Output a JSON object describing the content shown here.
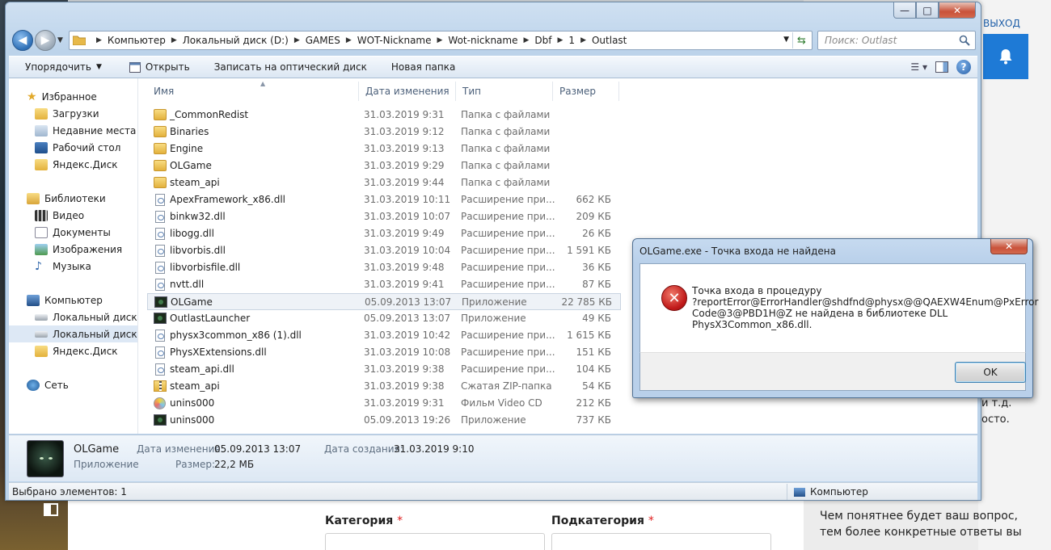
{
  "background": {
    "exit_link": "ВЫХОД",
    "side_fragments": [
      "и т.д.",
      "осто."
    ],
    "form": {
      "category_label": "Категория",
      "subcategory_label": "Подкатегория",
      "required_mark": "*"
    },
    "side_text": [
      "Чем понятнее будет ваш вопрос,",
      "тем более конкретные ответы вы"
    ]
  },
  "explorer": {
    "window_controls": {
      "minimize": "—",
      "maximize": "□",
      "close": "✕"
    },
    "breadcrumbs": [
      "Компьютер",
      "Локальный диск (D:)",
      "GAMES",
      "WOT-Nickname",
      "Wot-nickname",
      "Dbf",
      "1",
      "Outlast"
    ],
    "search_placeholder": "Поиск: Outlast",
    "toolbar": {
      "organize": "Упорядочить",
      "open": "Открыть",
      "burn": "Записать на оптический диск",
      "new_folder": "Новая папка"
    },
    "nav": {
      "favorites": "Избранное",
      "downloads": "Загрузки",
      "recent": "Недавние места",
      "desktop": "Рабочий стол",
      "yadisk": "Яндекс.Диск",
      "libraries": "Библиотеки",
      "video": "Видео",
      "documents": "Документы",
      "images": "Изображения",
      "music": "Музыка",
      "computer": "Компьютер",
      "local_c": "Локальный диск (C:)",
      "local_d": "Локальный диск (D:)",
      "yadisk2": "Яндекс.Диск",
      "network": "Сеть"
    },
    "columns": {
      "name": "Имя",
      "date": "Дата изменения",
      "type": "Тип",
      "size": "Размер"
    },
    "files": [
      {
        "name": "_CommonRedist",
        "date": "31.03.2019 9:31",
        "type": "Папка с файлами",
        "size": "",
        "icon": "folder"
      },
      {
        "name": "Binaries",
        "date": "31.03.2019 9:12",
        "type": "Папка с файлами",
        "size": "",
        "icon": "folder"
      },
      {
        "name": "Engine",
        "date": "31.03.2019 9:13",
        "type": "Папка с файлами",
        "size": "",
        "icon": "folder"
      },
      {
        "name": "OLGame",
        "date": "31.03.2019 9:29",
        "type": "Папка с файлами",
        "size": "",
        "icon": "folder"
      },
      {
        "name": "steam_api",
        "date": "31.03.2019 9:44",
        "type": "Папка с файлами",
        "size": "",
        "icon": "folder"
      },
      {
        "name": "ApexFramework_x86.dll",
        "date": "31.03.2019 10:11",
        "type": "Расширение при...",
        "size": "662 КБ",
        "icon": "dll"
      },
      {
        "name": "binkw32.dll",
        "date": "31.03.2019 10:07",
        "type": "Расширение при...",
        "size": "209 КБ",
        "icon": "dll"
      },
      {
        "name": "libogg.dll",
        "date": "31.03.2019 9:49",
        "type": "Расширение при...",
        "size": "26 КБ",
        "icon": "dll"
      },
      {
        "name": "libvorbis.dll",
        "date": "31.03.2019 10:04",
        "type": "Расширение при...",
        "size": "1 591 КБ",
        "icon": "dll"
      },
      {
        "name": "libvorbisfile.dll",
        "date": "31.03.2019 9:48",
        "type": "Расширение при...",
        "size": "36 КБ",
        "icon": "dll"
      },
      {
        "name": "nvtt.dll",
        "date": "31.03.2019 9:41",
        "type": "Расширение при...",
        "size": "87 КБ",
        "icon": "dll"
      },
      {
        "name": "OLGame",
        "date": "05.09.2013 13:07",
        "type": "Приложение",
        "size": "22 785 КБ",
        "icon": "app",
        "selected": true
      },
      {
        "name": "OutlastLauncher",
        "date": "05.09.2013 13:07",
        "type": "Приложение",
        "size": "49 КБ",
        "icon": "app"
      },
      {
        "name": "physx3common_x86 (1).dll",
        "date": "31.03.2019 10:42",
        "type": "Расширение при...",
        "size": "1 615 КБ",
        "icon": "dll"
      },
      {
        "name": "PhysXExtensions.dll",
        "date": "31.03.2019 10:08",
        "type": "Расширение при...",
        "size": "151 КБ",
        "icon": "dll"
      },
      {
        "name": "steam_api.dll",
        "date": "31.03.2019 9:38",
        "type": "Расширение при...",
        "size": "104 КБ",
        "icon": "dll"
      },
      {
        "name": "steam_api",
        "date": "31.03.2019 9:38",
        "type": "Сжатая ZIP-папка",
        "size": "54 КБ",
        "icon": "zip"
      },
      {
        "name": "unins000",
        "date": "31.03.2019 9:31",
        "type": "Фильм Video CD",
        "size": "212 КБ",
        "icon": "cd"
      },
      {
        "name": "unins000",
        "date": "05.09.2013 19:26",
        "type": "Приложение",
        "size": "737 КБ",
        "icon": "app"
      }
    ],
    "details": {
      "name": "OLGame",
      "kind": "Приложение",
      "modified_label": "Дата изменения:",
      "modified_value": "05.09.2013 13:07",
      "size_label": "Размер:",
      "size_value": "22,2 МБ",
      "created_label": "Дата создания:",
      "created_value": "31.03.2019 9:10"
    },
    "status": {
      "selected": "Выбрано элементов: 1",
      "location": "Компьютер"
    }
  },
  "dialog": {
    "title": "OLGame.exe - Точка входа не найдена",
    "close": "✕",
    "message_lines": [
      "Точка входа в процедуру",
      "?reportError@ErrorHandler@shdfnd@physx@@QAEXW4Enum@PxError",
      "Code@3@PBD1H@Z не найдена в библиотеке DLL",
      "PhysX3Common_x86.dll."
    ],
    "ok_label": "OK"
  }
}
